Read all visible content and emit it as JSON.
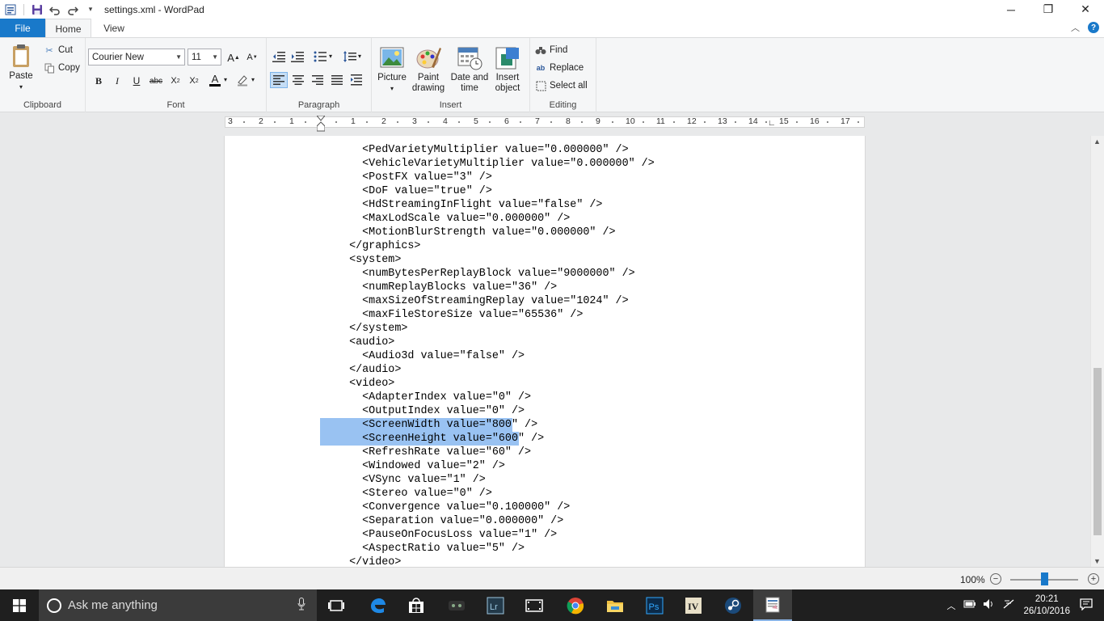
{
  "window": {
    "title": "settings.xml - WordPad"
  },
  "tabs": [
    {
      "label": "File"
    },
    {
      "label": "Home"
    },
    {
      "label": "View"
    }
  ],
  "ribbon": {
    "clipboard": {
      "label": "Clipboard",
      "paste": "Paste",
      "cut": "Cut",
      "copy": "Copy"
    },
    "font": {
      "label": "Font",
      "family": "Courier New",
      "size": "11"
    },
    "paragraph": {
      "label": "Paragraph"
    },
    "insert": {
      "label": "Insert",
      "picture": "Picture",
      "paint_line1": "Paint",
      "paint_line2": "drawing",
      "datetime_line1": "Date and",
      "datetime_line2": "time",
      "object_line1": "Insert",
      "object_line2": "object"
    },
    "editing": {
      "label": "Editing",
      "find": "Find",
      "replace": "Replace",
      "select_all": "Select all"
    }
  },
  "ruler": {
    "numbers": [
      "3",
      "2",
      "1",
      "1",
      "2",
      "3",
      "4",
      "5",
      "6",
      "7",
      "8",
      "9",
      "10",
      "11",
      "12",
      "13",
      "14",
      "15",
      "16",
      "17"
    ]
  },
  "document": {
    "lines": [
      "    <PedVarietyMultiplier value=\"0.000000\" />",
      "    <VehicleVarietyMultiplier value=\"0.000000\" />",
      "    <PostFX value=\"3\" />",
      "    <DoF value=\"true\" />",
      "    <HdStreamingInFlight value=\"false\" />",
      "    <MaxLodScale value=\"0.000000\" />",
      "    <MotionBlurStrength value=\"0.000000\" />",
      "  </graphics>",
      "  <system>",
      "    <numBytesPerReplayBlock value=\"9000000\" />",
      "    <numReplayBlocks value=\"36\" />",
      "    <maxSizeOfStreamingReplay value=\"1024\" />",
      "    <maxFileStoreSize value=\"65536\" />",
      "  </system>",
      "  <audio>",
      "    <Audio3d value=\"false\" />",
      "  </audio>",
      "  <video>",
      "    <AdapterIndex value=\"0\" />",
      "    <OutputIndex value=\"0\" />",
      "    <ScreenWidth value=\"800\" />",
      "    <ScreenHeight value=\"600\" />",
      "    <RefreshRate value=\"60\" />",
      "    <Windowed value=\"2\" />",
      "    <VSync value=\"1\" />",
      "    <Stereo value=\"0\" />",
      "    <Convergence value=\"0.100000\" />",
      "    <Separation value=\"0.000000\" />",
      "    <PauseOnFocusLoss value=\"1\" />",
      "    <AspectRatio value=\"5\" />",
      "  </video>"
    ],
    "selected_lines": [
      20,
      21
    ]
  },
  "status": {
    "zoom": "100%",
    "zoom_level": 1.0
  },
  "taskbar": {
    "search_placeholder": "Ask me anything",
    "apps": [
      "task-view",
      "edge",
      "store",
      "game",
      "lightroom",
      "video-editor",
      "chrome",
      "file-explorer",
      "photoshop",
      "nvidia",
      "steam",
      "wordpad"
    ],
    "time": "20:21",
    "date": "26/10/2016"
  }
}
